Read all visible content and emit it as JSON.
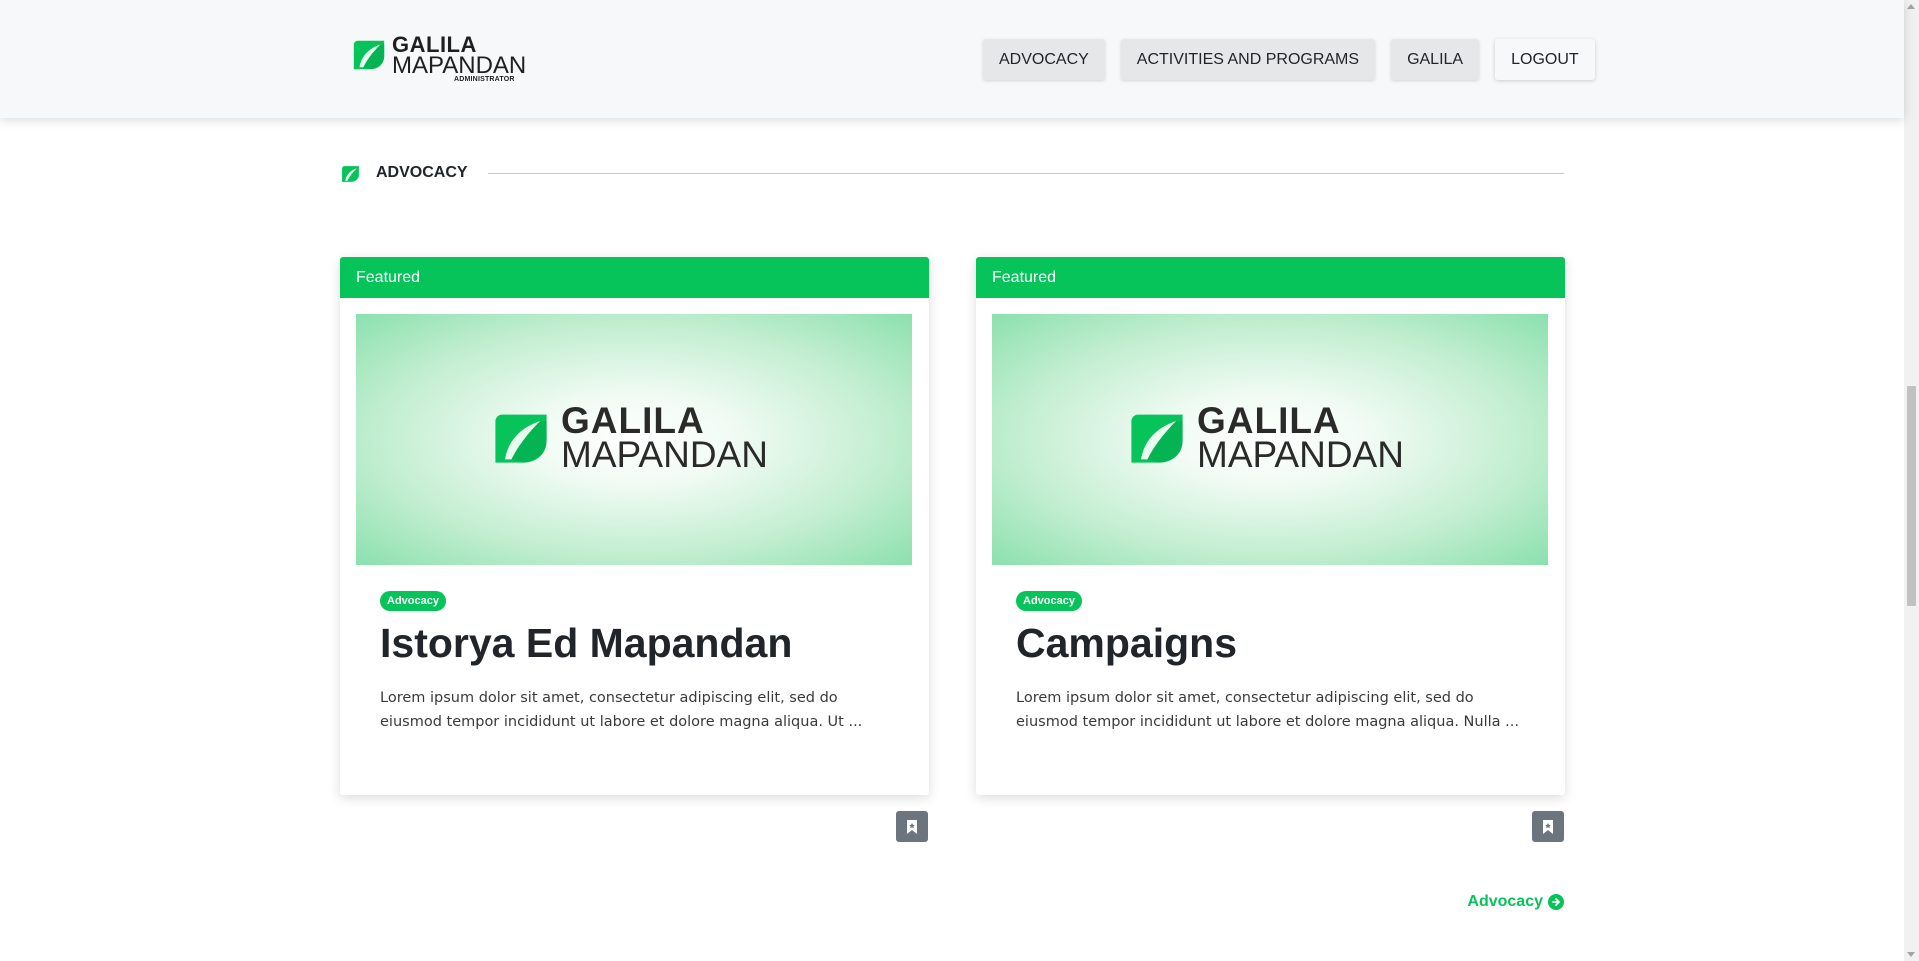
{
  "brand": {
    "line1": "GALILA",
    "line2": "MAPANDAN",
    "line3": "ADMINISTRATOR"
  },
  "nav": {
    "items": [
      {
        "label": "ADVOCACY"
      },
      {
        "label": "ACTIVITIES AND PROGRAMS"
      },
      {
        "label": "GALILA"
      },
      {
        "label": "LOGOUT"
      }
    ]
  },
  "section": {
    "title": "ADVOCACY"
  },
  "cards": [
    {
      "ribbon": "Featured",
      "thumb_line1": "GALILA",
      "thumb_line2": "MAPANDAN",
      "tag": "Advocacy",
      "title": "Istorya Ed Mapandan",
      "excerpt": "Lorem ipsum dolor sit amet, consectetur adipiscing elit, sed do eiusmod tempor incididunt ut labore et dolore magna aliqua. Ut ..."
    },
    {
      "ribbon": "Featured",
      "thumb_line1": "GALILA",
      "thumb_line2": "MAPANDAN",
      "tag": "Advocacy",
      "title": "Campaigns",
      "excerpt": "Lorem ipsum dolor sit amet, consectetur adipiscing elit, sed do eiusmod tempor incididunt ut labore et dolore magna aliqua. Nulla ..."
    }
  ],
  "more_link": {
    "label": "Advocacy"
  },
  "icons": {
    "brand_leaf": "leaf-logo-icon",
    "bookmark": "bookmark-icon",
    "more_arrow": "arrow-right-circle-icon"
  },
  "colors": {
    "accent": "#06c35a",
    "accent_dark": "#04a64b",
    "navbar_bg": "#f7f8fa",
    "nav_button_bg": "#e6e7e9",
    "bookmark_bg": "#6c757d",
    "text": "#212529"
  }
}
